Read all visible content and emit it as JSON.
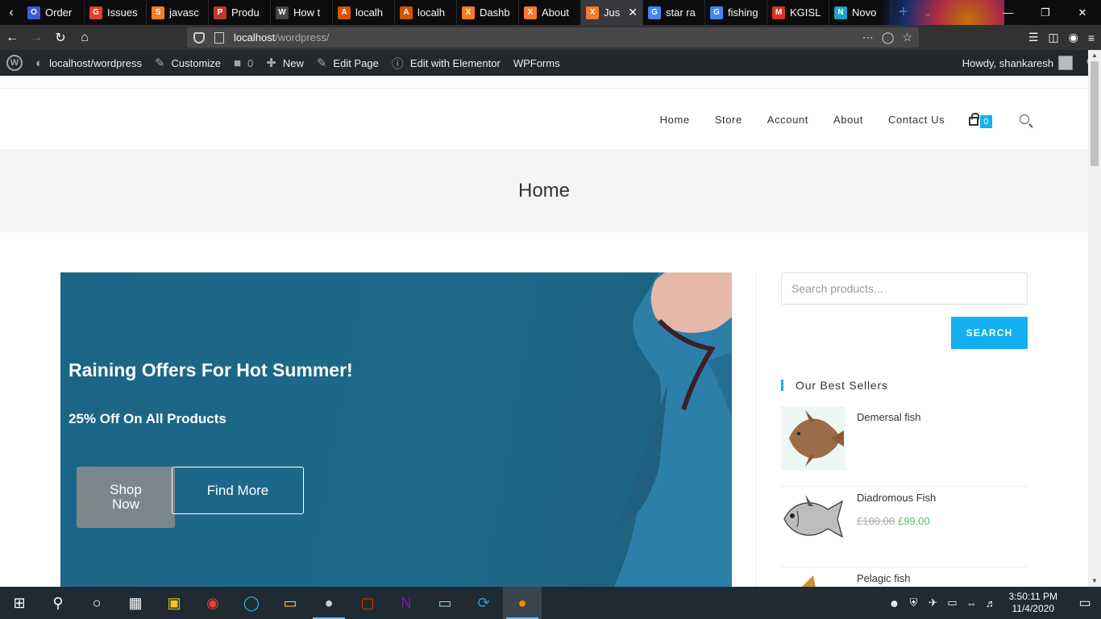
{
  "browser": {
    "tabs": [
      {
        "label": "Order",
        "color": "#3b5bdb",
        "glyph": "O"
      },
      {
        "label": "Issues",
        "color": "#e24329",
        "glyph": "G"
      },
      {
        "label": "javasc",
        "color": "#f48024",
        "glyph": "S"
      },
      {
        "label": "Produ",
        "color": "#c0392b",
        "glyph": "P"
      },
      {
        "label": "How t",
        "color": "#464646",
        "glyph": "W"
      },
      {
        "label": "localh",
        "color": "#d35400",
        "glyph": "A"
      },
      {
        "label": "localh",
        "color": "#d35400",
        "glyph": "A"
      },
      {
        "label": "Dashb",
        "color": "#fb7a24",
        "glyph": "X"
      },
      {
        "label": "About",
        "color": "#fb7a24",
        "glyph": "X"
      },
      {
        "label": "Jus",
        "color": "#fb7a24",
        "glyph": "X",
        "active": true
      },
      {
        "label": "star ra",
        "color": "#4285f4",
        "glyph": "G"
      },
      {
        "label": "fishing",
        "color": "#4285f4",
        "glyph": "G"
      },
      {
        "label": "KGISL",
        "color": "#d93025",
        "glyph": "M"
      },
      {
        "label": "Novo",
        "color": "#1aa3c9",
        "glyph": "N"
      }
    ],
    "url_host": "localhost",
    "url_path": "/wordpress/"
  },
  "wpbar": {
    "site": "localhost/wordpress",
    "customize": "Customize",
    "comments": "0",
    "new": "New",
    "edit_page": "Edit Page",
    "elementor": "Edit with Elementor",
    "wpforms": "WPForms",
    "howdy": "Howdy, shankaresh"
  },
  "nav": {
    "items": [
      "Home",
      "Store",
      "Account",
      "About",
      "Contact Us"
    ],
    "cart_count": "0"
  },
  "page": {
    "title": "Home"
  },
  "hero": {
    "heading": "Raining Offers For Hot Summer!",
    "subheading": "25% Off On All Products",
    "shop_label": "Shop Now",
    "find_label": "Find More"
  },
  "sidebar": {
    "search_placeholder": "Search products...",
    "search_button": "SEARCH",
    "widget_title": "Our Best Sellers",
    "products": [
      {
        "name": "Demersal fish",
        "old_price": "",
        "price": ""
      },
      {
        "name": "Diadromous Fish",
        "old_price": "£100.00",
        "price": "£99.00"
      },
      {
        "name": "Pelagic fish",
        "old_price": "",
        "price": ""
      }
    ]
  },
  "taskbar": {
    "time": "3:50:11 PM",
    "date": "11/4/2020"
  }
}
